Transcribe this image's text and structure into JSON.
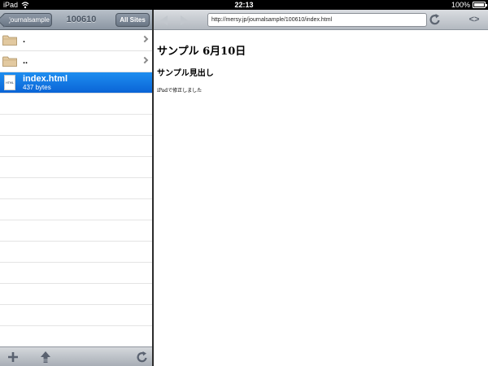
{
  "status_bar": {
    "carrier": "iPad",
    "time": "22:13",
    "battery": "100%"
  },
  "left_pane": {
    "back_label": "journalsample",
    "title": "100610",
    "all_sites_label": "All Sites",
    "items": [
      {
        "name": "."
      },
      {
        "name": ".."
      },
      {
        "name": "index.html",
        "size": "437 bytes",
        "icon_text": "HTML"
      }
    ]
  },
  "browser": {
    "url": "http://mersy.jp/journalsample/100610/index.html",
    "source_label": "<>"
  },
  "page": {
    "heading": "サンプル 6月10日",
    "subheading": "サンプル見出し",
    "body": "iPadで修正しました"
  },
  "colors": {
    "selection": "#0a64d6",
    "toolbar": "#8b96a3"
  },
  "icons": {
    "add": "plus-icon",
    "upload": "upload-icon",
    "refresh": "refresh-icon"
  }
}
